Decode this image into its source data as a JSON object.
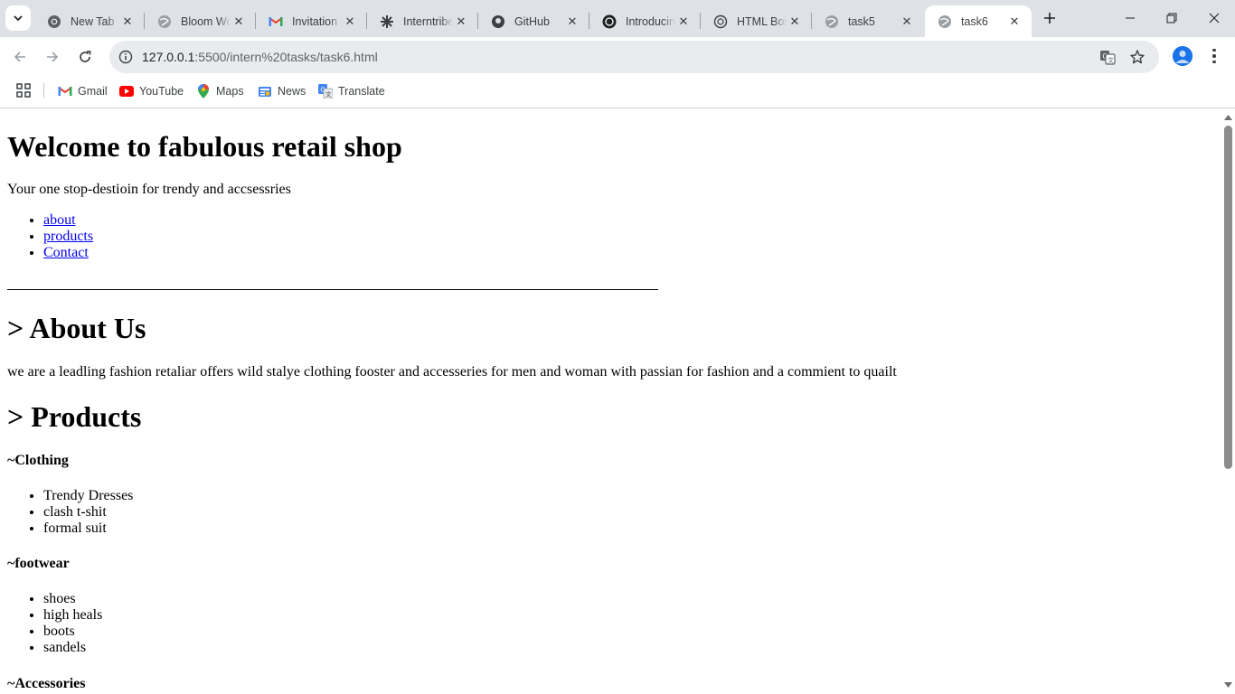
{
  "browser": {
    "tabs": [
      {
        "title": "New Tab",
        "favicon": "chrome-icon"
      },
      {
        "title": "Bloom Work",
        "favicon": "globe-icon"
      },
      {
        "title": "Invitation",
        "favicon": "gmail-icon"
      },
      {
        "title": "Interntribe",
        "favicon": "interntribe-icon"
      },
      {
        "title": "GitHub",
        "favicon": "github-icon"
      },
      {
        "title": "Introducing",
        "favicon": "openai-icon"
      },
      {
        "title": "HTML Boilerplate",
        "favicon": "openai-icon"
      },
      {
        "title": "task5",
        "favicon": "globe-icon"
      },
      {
        "title": "task6",
        "favicon": "globe-icon",
        "active": true
      }
    ],
    "address_bar": {
      "host": "127.0.0.1",
      "path": ":5500/intern%20tasks/task6.html"
    },
    "bookmarks": [
      {
        "label": "Gmail",
        "icon": "gmail-icon"
      },
      {
        "label": "YouTube",
        "icon": "youtube-icon"
      },
      {
        "label": "Maps",
        "icon": "maps-icon"
      },
      {
        "label": "News",
        "icon": "news-icon"
      },
      {
        "label": "Translate",
        "icon": "translate-icon"
      }
    ],
    "colors": {
      "tabstrip": "#dee1e6",
      "omnibox": "#e9ebee",
      "link": "#0000ee",
      "accent": "#1a73e8"
    }
  },
  "page": {
    "title": "Welcome to fabulous retail shop",
    "tagline": "Your one stop-destioin for trendy and accsessries",
    "nav_links": [
      "about",
      "products",
      "Contact"
    ],
    "about": {
      "heading": "> About Us",
      "text": "we are a leadling fashion retaliar offers wild stalye clothing fooster and accesseries for men and woman with passian for fashion and a commient to quailt"
    },
    "products": {
      "heading": "> Products",
      "categories": [
        {
          "name": "~Clothing",
          "items": [
            "Trendy Dresses",
            "clash t-shit",
            "formal suit"
          ]
        },
        {
          "name": "~footwear",
          "items": [
            "shoes",
            "high heals",
            "boots",
            "sandels"
          ]
        },
        {
          "name": "~Accessories",
          "items": []
        }
      ]
    }
  }
}
